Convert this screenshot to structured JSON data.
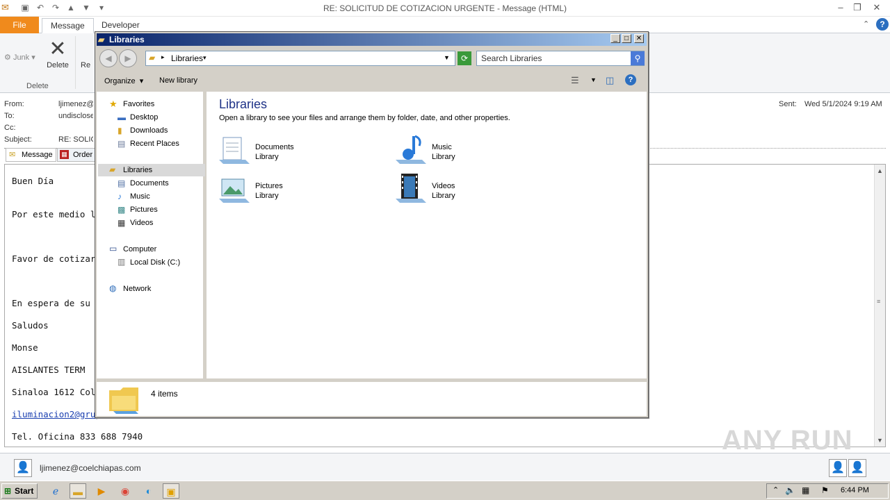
{
  "outlook": {
    "title": "RE: SOLICITUD DE COTIZACION URGENTE  -  Message (HTML)",
    "tabs": [
      "File",
      "Message",
      "Developer"
    ],
    "ribbon": {
      "junk": "Junk",
      "delete": "Delete",
      "reply_partial": "Re",
      "group_delete": "Delete"
    },
    "header": {
      "from_label": "From:",
      "from_value": "ljimenez@coelchiapas.com",
      "to_label": "To:",
      "to_value": "undisclosed-recipients",
      "cc_label": "Cc:",
      "subject_label": "Subject:",
      "subject_value": "RE: SOLICITUD DE COTIZACION URGENTE",
      "sent_label": "Sent:",
      "sent_value": "Wed 5/1/2024 9:19 AM"
    },
    "message_tabs": [
      "Message",
      "Order"
    ],
    "body_lines": [
      "Buen Día",
      "Por este medio le",
      "Favor de cotizar L",
      "En espera de su c",
      "Saludos",
      "Monse",
      "AISLANTES TERM",
      "Sinaloa 1612 Col.",
      "iluminacion2@grup",
      "Tel. Oficina 833 688 7940"
    ],
    "footer_email": "ljimenez@coelchiapas.com",
    "watermark": "ANY RUN"
  },
  "explorer": {
    "title": "Libraries",
    "address": "Libraries",
    "search_placeholder": "Search Libraries",
    "commands": {
      "organize": "Organize",
      "new_library": "New library"
    },
    "nav": {
      "favorites": "Favorites",
      "favorites_items": [
        "Desktop",
        "Downloads",
        "Recent Places"
      ],
      "libraries": "Libraries",
      "libraries_items": [
        "Documents",
        "Music",
        "Pictures",
        "Videos"
      ],
      "computer": "Computer",
      "computer_items": [
        "Local Disk (C:)"
      ],
      "network": "Network"
    },
    "heading": "Libraries",
    "subtitle": "Open a library to see your files and arrange them by folder, date, and other properties.",
    "libraries": [
      {
        "name": "Documents",
        "type": "Library"
      },
      {
        "name": "Music",
        "type": "Library"
      },
      {
        "name": "Pictures",
        "type": "Library"
      },
      {
        "name": "Videos",
        "type": "Library"
      }
    ],
    "status": "4 items"
  },
  "taskbar": {
    "start": "Start",
    "time": "6:44 PM"
  }
}
